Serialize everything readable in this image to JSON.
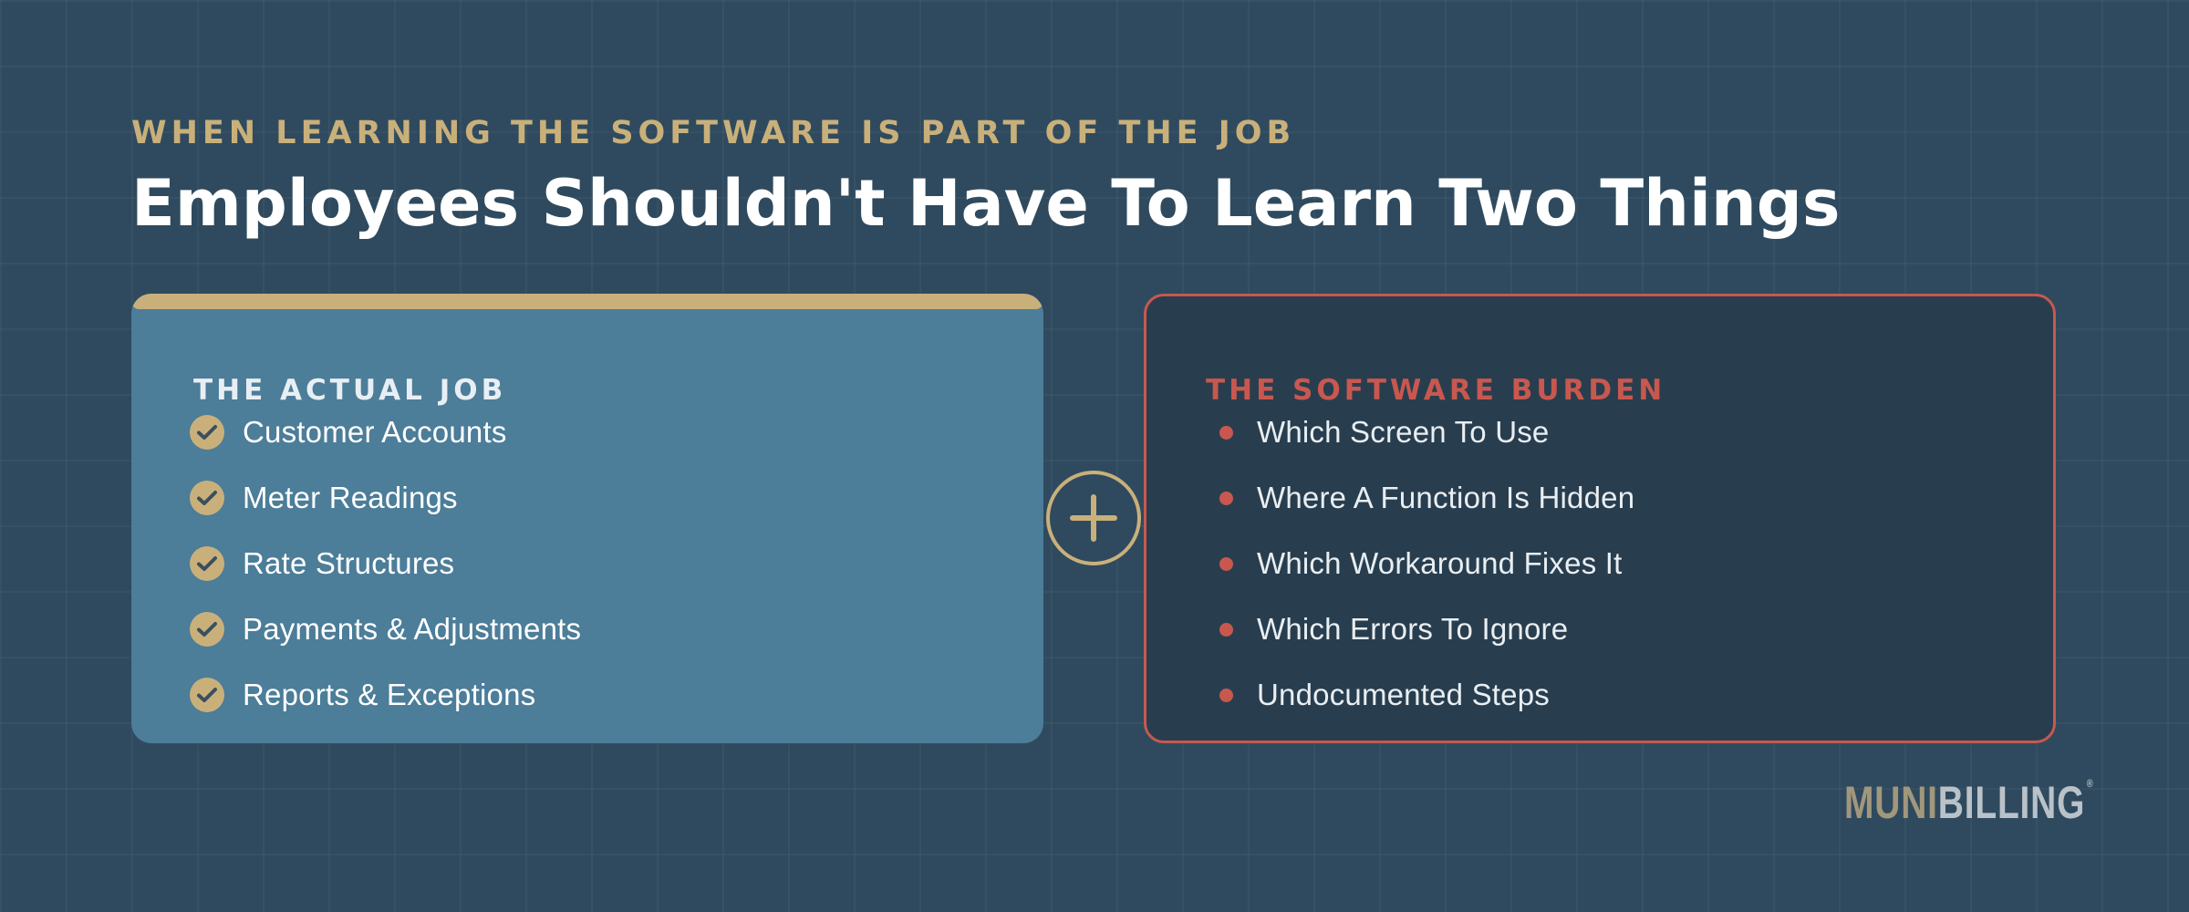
{
  "header": {
    "eyebrow": "WHEN LEARNING THE SOFTWARE IS PART OF THE JOB",
    "title": "Employees Shouldn't Have To Learn Two Things"
  },
  "left_card": {
    "heading": "THE ACTUAL JOB",
    "icon": "check-circle-icon",
    "items": [
      "Customer Accounts",
      "Meter Readings",
      "Rate Structures",
      "Payments & Adjustments",
      "Reports & Exceptions"
    ]
  },
  "connector": {
    "icon": "plus-icon"
  },
  "right_card": {
    "heading": "THE SOFTWARE BURDEN",
    "icon": "bullet-dot-icon",
    "items": [
      "Which Screen To Use",
      "Where A Function Is Hidden",
      "Which Workaround Fixes It",
      "Which Errors To Ignore",
      "Undocumented Steps"
    ]
  },
  "logo": {
    "part1": "MUNI",
    "part2": "BILLING",
    "mark": "®"
  },
  "colors": {
    "background": "#2f4a5e",
    "gold": "#c9b07a",
    "left_card": "#4c7d99",
    "right_card": "#283e4f",
    "accent_red": "#c8584f",
    "left_heading": "#e8eff4",
    "logo_light": "#b9c2c9",
    "logo_gold": "#a1977c"
  }
}
